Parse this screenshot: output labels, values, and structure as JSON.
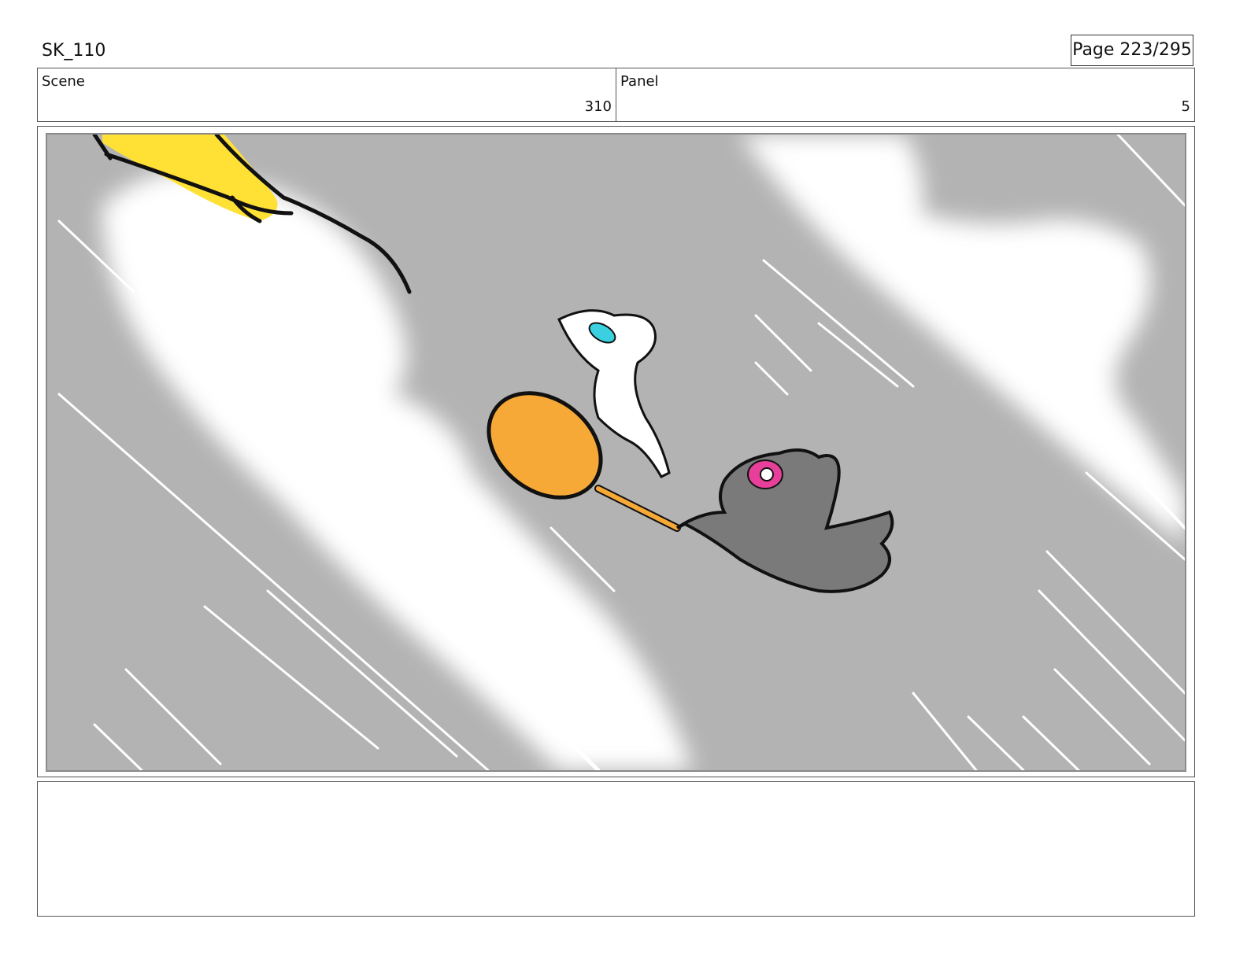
{
  "header": {
    "title": "SK_110",
    "page": "Page 223/295"
  },
  "info": {
    "scene_label": "Scene",
    "scene_value": "310",
    "panel_label": "Panel",
    "panel_value": "5"
  },
  "frame": {
    "background_color": "#b3b3b3",
    "cloud_color": "#ffffff",
    "lamp_color": "#ffe135",
    "pan_color": "#f7a937",
    "white_creature_eye_color": "#3ad0e0",
    "gray_creature_color": "#7a7a7a",
    "gray_creature_eye_color": "#e8409a"
  },
  "notes": {
    "text": ""
  }
}
